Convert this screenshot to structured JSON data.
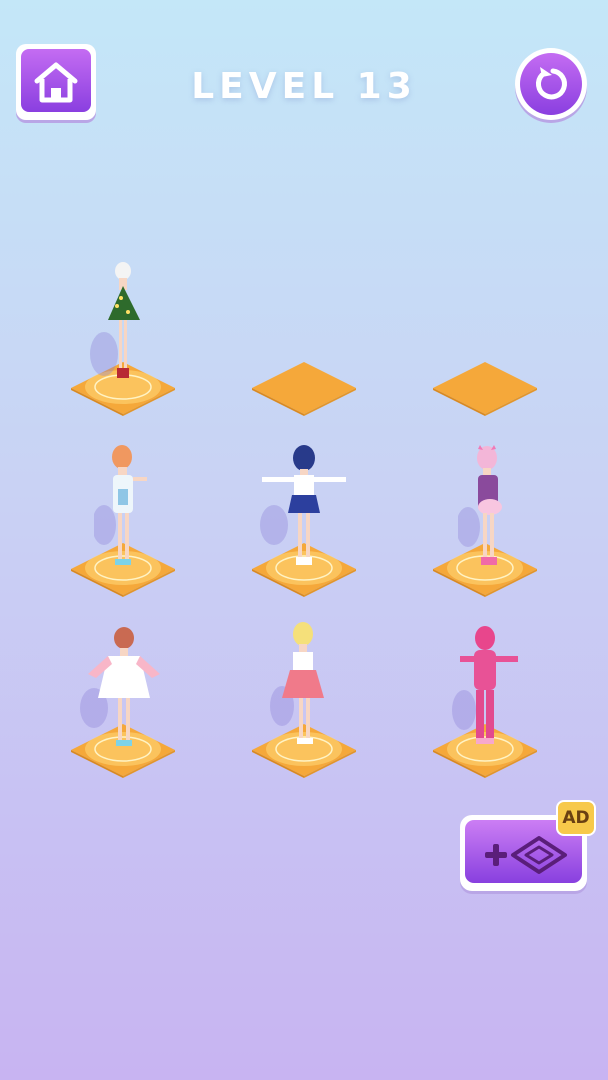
{
  "header": {
    "level_label": "LEVEL 13",
    "home_icon": "house-icon",
    "restart_icon": "restart-arrow-icon"
  },
  "colors": {
    "button_purple": "#9a4ee6",
    "tile_orange": "#f5a83a",
    "magic_circle": "#ffd87a"
  },
  "grid": {
    "rows": [
      [
        {
          "occupied": true,
          "figure": "green-floral-dress-girl"
        },
        {
          "occupied": false
        },
        {
          "occupied": false
        }
      ],
      [
        {
          "occupied": true,
          "figure": "orange-hair-white-dress-girl"
        },
        {
          "occupied": true,
          "figure": "sailor-uniform-girl"
        },
        {
          "occupied": true,
          "figure": "pink-cat-ear-girl"
        }
      ],
      [
        {
          "occupied": true,
          "figure": "white-pink-dress-girl"
        },
        {
          "occupied": true,
          "figure": "blonde-pink-skirt-girl"
        },
        {
          "occupied": true,
          "figure": "pink-tracksuit-girl"
        }
      ]
    ]
  },
  "add_slot_button": {
    "icons": [
      "plus-icon",
      "diamond-tile-icon"
    ],
    "badge": "AD"
  }
}
